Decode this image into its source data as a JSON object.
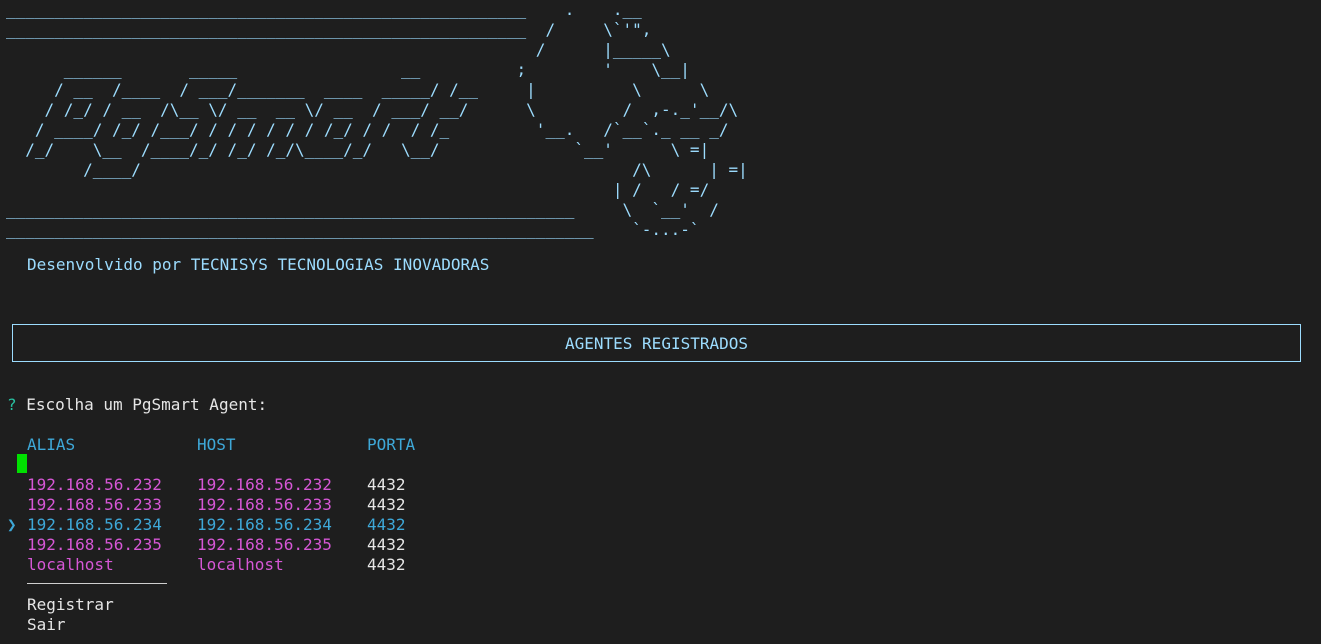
{
  "banner": {
    "art": "______________________________________________________    .    .__                \n______________________________________________________  /     \\`'\",           \n                                                       /      |_____\\          \n      ______       _____                 __          ;        '    \\__|         \n     / __  /____  / ___/_______  ____  _____/ /__     |          \\      \\         \n    / /_/ / __  /\\__ \\/ __  __ \\/ __  / ___/ __/      \\         /  ,-._'__/\\      \n   / ____/ /_/ /___/ / / / / / / /_/ / /  / /_         '__.   /`__`._ __ _/       \n  /_/    \\__  /____/_/ /_/ /_/\\____/_/   \\__/              `__'      \\ =|       \n        /____/                                                   /\\      | =|  \n                                                               | /   / =/      \n___________________________________________________________     \\  `__'  /      \n_____________________________________________________________    `-...-`        "
  },
  "credit": "Desenvolvido por TECNISYS TECNOLOGIAS INOVADORAS",
  "header": {
    "title": "AGENTES REGISTRADOS"
  },
  "prompt": {
    "mark": "?",
    "question": "Escolha um PgSmart Agent:"
  },
  "table": {
    "columns": [
      "ALIAS",
      "HOST",
      "PORTA"
    ],
    "pointer": "❯",
    "selected_index": 2,
    "rows": [
      {
        "alias": "192.168.56.232",
        "host": "192.168.56.232",
        "port": "4432"
      },
      {
        "alias": "192.168.56.233",
        "host": "192.168.56.233",
        "port": "4432"
      },
      {
        "alias": "192.168.56.234",
        "host": "192.168.56.234",
        "port": "4432"
      },
      {
        "alias": "192.168.56.235",
        "host": "192.168.56.235",
        "port": "4432"
      },
      {
        "alias": "localhost",
        "host": "localhost",
        "port": "4432"
      }
    ]
  },
  "menu": {
    "register_label": "Registrar",
    "exit_label": "Sair"
  },
  "colors": {
    "background": "#1e1e1e",
    "banner": "#9cdcfe",
    "header_text": "#3ea8d8",
    "row_text": "#d657d6",
    "question_mark": "#28c1a1",
    "cursor": "#00e000"
  }
}
